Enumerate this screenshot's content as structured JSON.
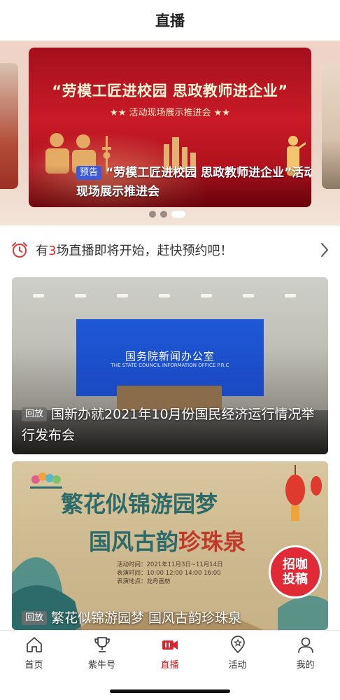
{
  "header": {
    "title": "直播"
  },
  "banner": {
    "card_title": "“劳模工匠进校园 思政教师进企业”",
    "card_subtitle": "★★ 活动现场展示推进会 ★★",
    "tag": "预告",
    "caption": "“劳模工匠进校园 思政教师进企业”活动现场展示推进会",
    "slides": 3,
    "active_slide": 3
  },
  "notice": {
    "prefix": "有",
    "count": "3",
    "suffix": "场直播即将开始，赶快预约吧！",
    "icon": "alarm-clock-icon"
  },
  "videos": [
    {
      "tag": "回放",
      "title": "国新办就2021年10月份国民经济运行情况举行发布会",
      "screen_cn": "国务院新闻办公室",
      "screen_en": "THE STATE COUNCIL INFORMATION OFFICE P.R.C"
    },
    {
      "tag": "回放",
      "title": "繁花似锦游园梦 国风古韵珍珠泉",
      "poster_line1": "繁花似锦游园梦",
      "poster_line2a": "国风古韵",
      "poster_line2b": "珍珠泉",
      "info_time": "活动时间：2021年11月3日~11月14日",
      "info_shows": "表演时间：10:00  12:00  14:00  16:00",
      "info_place": "表演地点：龙舟画舫",
      "stamp_line1": "招咖",
      "stamp_line2": "投稿"
    }
  ],
  "tabbar": {
    "items": [
      {
        "label": "首页",
        "icon": "home-icon"
      },
      {
        "label": "紫牛号",
        "icon": "trophy-icon"
      },
      {
        "label": "直播",
        "icon": "live-camera-icon"
      },
      {
        "label": "活动",
        "icon": "star-pin-icon"
      },
      {
        "label": "我的",
        "icon": "user-icon"
      }
    ],
    "active": "直播"
  },
  "colors": {
    "accent": "#d8242c",
    "tag_preview": "#3d5bd9",
    "count": "#e12a2a"
  }
}
